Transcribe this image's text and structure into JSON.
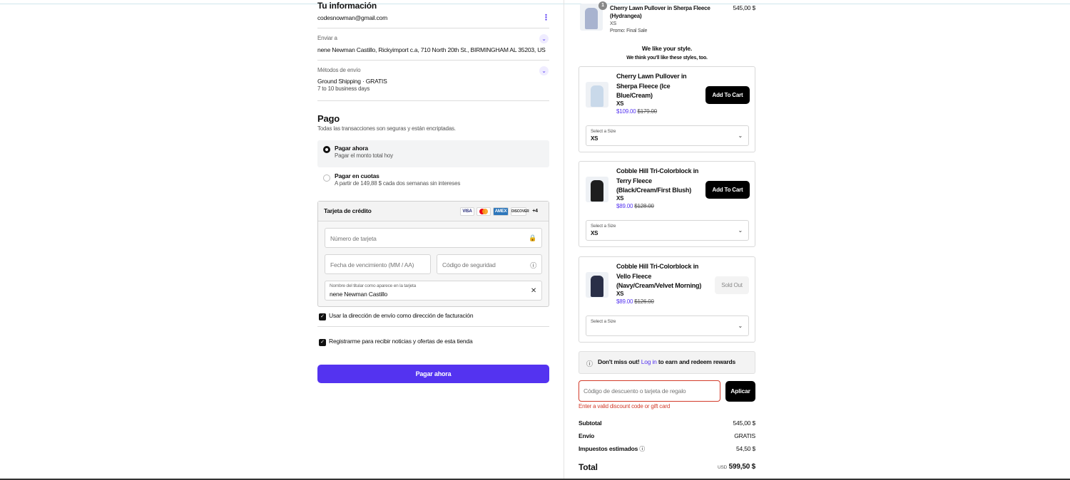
{
  "info": {
    "title": "Tu información",
    "email": "codesnowman@gmail.com",
    "menu_icon": "more-vertical-icon"
  },
  "shipping": {
    "label": "Enviar a",
    "value": "nene Newman Castillo, Rickyimport c.a, 710 North 20th St., BIRMINGHAM AL 35203, US"
  },
  "method": {
    "label": "Métodos de envío",
    "value": "Ground Shipping · GRATIS",
    "eta": "7 to 10 business days"
  },
  "payment": {
    "title": "Pago",
    "subtitle": "Todas las transacciones son seguras y están encriptadas.",
    "option_now": {
      "title": "Pagar ahora",
      "sub": "Pagar el monto total hoy"
    },
    "option_installments": {
      "title": "Pagar en cuotas",
      "sub": "A partir de 149,88 $ cada dos semanas sin intereses"
    },
    "card_title": "Tarjeta de crédito",
    "brands": [
      "VISA",
      "MC",
      "AMEX",
      "DISCOVER",
      "+4"
    ],
    "card_number_placeholder": "Número de tarjeta",
    "expiry_placeholder": "Fecha de vencimiento (MM / AA)",
    "cvv_placeholder": "Código de seguridad",
    "holder_label": "Nombre del titular como aparece en la tarjeta",
    "holder_value": "nene Newman Castillo",
    "billing_checkbox": "Usar la dirección de envío como dirección de facturación",
    "news_checkbox": "Registrarme para recibir noticias y ofertas de esta tienda",
    "pay_button": "Pagar ahora"
  },
  "cart": {
    "item": {
      "name": "Cherry Lawn Pullover in Sherpa Fleece (Hydrangea)",
      "size": "XS",
      "promo": "Promo: Final Sale",
      "price": "545,00 $"
    }
  },
  "recommend": {
    "title": "We like your style.",
    "subtitle": "We think you'll like these styles, too.",
    "select_label": "Select a Size",
    "items": [
      {
        "name": "Cherry Lawn Pullover in Sherpa Fleece (Ice Blue/Cream)",
        "size": "XS",
        "price": "$109.00",
        "old": "$179.00",
        "button": "Add To Cart",
        "selected_size": "XS"
      },
      {
        "name": "Cobble Hill Tri-Colorblock in Terry Fleece (Black/Cream/First Blush)",
        "size": "XS",
        "price": "$89.00",
        "old": "$128.00",
        "button": "Add To Cart",
        "selected_size": "XS"
      },
      {
        "name": "Cobble Hill Tri-Colorblock in Vello Fleece (Navy/Cream/Velvet Morning)",
        "size": "XS",
        "price": "$89.00",
        "old": "$126.00",
        "button": "Sold Out",
        "selected_size": ""
      }
    ]
  },
  "rewards": {
    "prefix": "Don't miss out!",
    "link": "Log in",
    "suffix": "to earn and redeem rewards"
  },
  "discount": {
    "placeholder": "Código de descuento o tarjeta de regalo",
    "button": "Aplicar",
    "error": "Enter a valid discount code or gift card"
  },
  "summary": {
    "subtotal_label": "Subtotal",
    "subtotal": "545,00 $",
    "shipping_label": "Envío",
    "shipping": "GRATIS",
    "tax_label": "Impuestos estimados",
    "tax": "54,50 $",
    "total_label": "Total",
    "currency": "USD",
    "total": "599,50 $"
  },
  "colors": {
    "accent": "#5433f0",
    "error": "#d23b2a"
  }
}
